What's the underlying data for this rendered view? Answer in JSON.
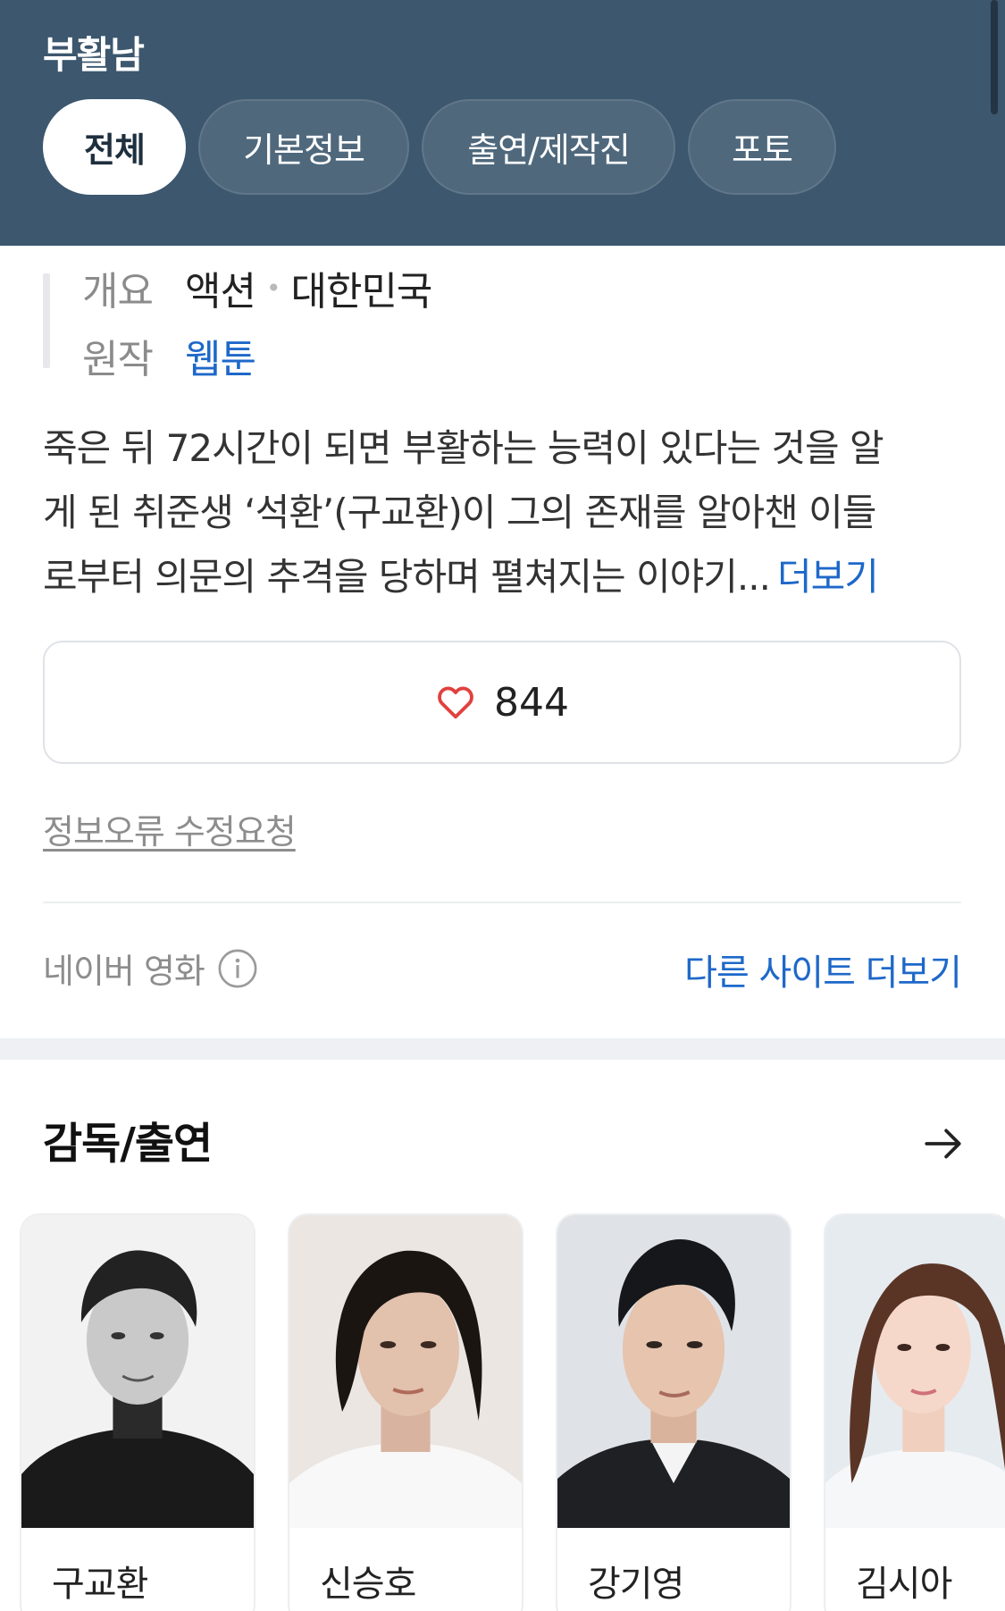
{
  "header": {
    "title": "부활남",
    "tabs": [
      {
        "label": "전체",
        "active": true
      },
      {
        "label": "기본정보",
        "active": false
      },
      {
        "label": "출연/제작진",
        "active": false
      },
      {
        "label": "포토",
        "active": false
      }
    ]
  },
  "info": {
    "overview_label": "개요",
    "genre": "액션",
    "country": "대한민국",
    "origin_label": "원작",
    "origin_value": "웹툰"
  },
  "synopsis": {
    "line1": "죽은 뒤 72시간이 되면 부활하는 능력이 있다는 것을 알",
    "line2": "게 된 취준생 ‘석환’(구교환)이 그의 존재를 알아챈 이들",
    "line3": "로부터 의문의 추격을 당하며 펼쳐지는 이야기...",
    "more": "더보기"
  },
  "like": {
    "count": "844",
    "icon": "heart-icon"
  },
  "report_link": "정보오류 수정요청",
  "source": {
    "label": "네이버 영화",
    "icon": "info-icon",
    "other_sites": "다른 사이트 더보기"
  },
  "cast": {
    "title": "감독/출연",
    "arrow_icon": "arrow-right-icon",
    "members": [
      {
        "name": "구교환"
      },
      {
        "name": "신승호"
      },
      {
        "name": "강기영"
      },
      {
        "name": "김시아"
      }
    ]
  },
  "colors": {
    "header_bg": "#3c576e",
    "link_blue": "#1e68c9",
    "heart_red": "#e0413d"
  }
}
